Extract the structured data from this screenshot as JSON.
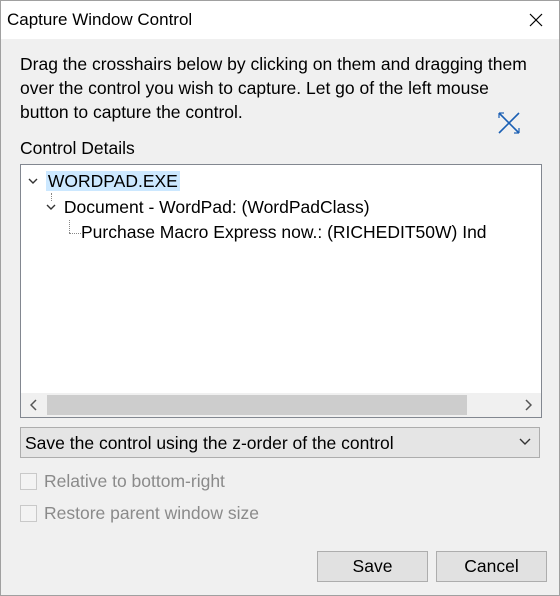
{
  "window": {
    "title": "Capture Window Control"
  },
  "instructions": "Drag the crosshairs below by clicking on them and dragging them over the control you wish to capture. Let go of the left mouse button to capture the control.",
  "details_label": "Control Details",
  "tree": {
    "nodes": [
      {
        "label": "WORDPAD.EXE",
        "selected": true,
        "expanded": true
      },
      {
        "label": "Document - WordPad: (WordPadClass)",
        "expanded": true
      },
      {
        "label": "Purchase Macro Express now.: (RICHEDIT50W) Ind"
      }
    ]
  },
  "combo": {
    "selected": "Save the control using the z-order of the control"
  },
  "options": {
    "relative_label": "Relative to bottom-right",
    "restore_label": "Restore parent window size"
  },
  "buttons": {
    "save": "Save",
    "cancel": "Cancel"
  },
  "colors": {
    "accent_selection": "#cce8ff",
    "crosshair": "#1a5fb4",
    "disabled_text": "#8a8a8a"
  }
}
